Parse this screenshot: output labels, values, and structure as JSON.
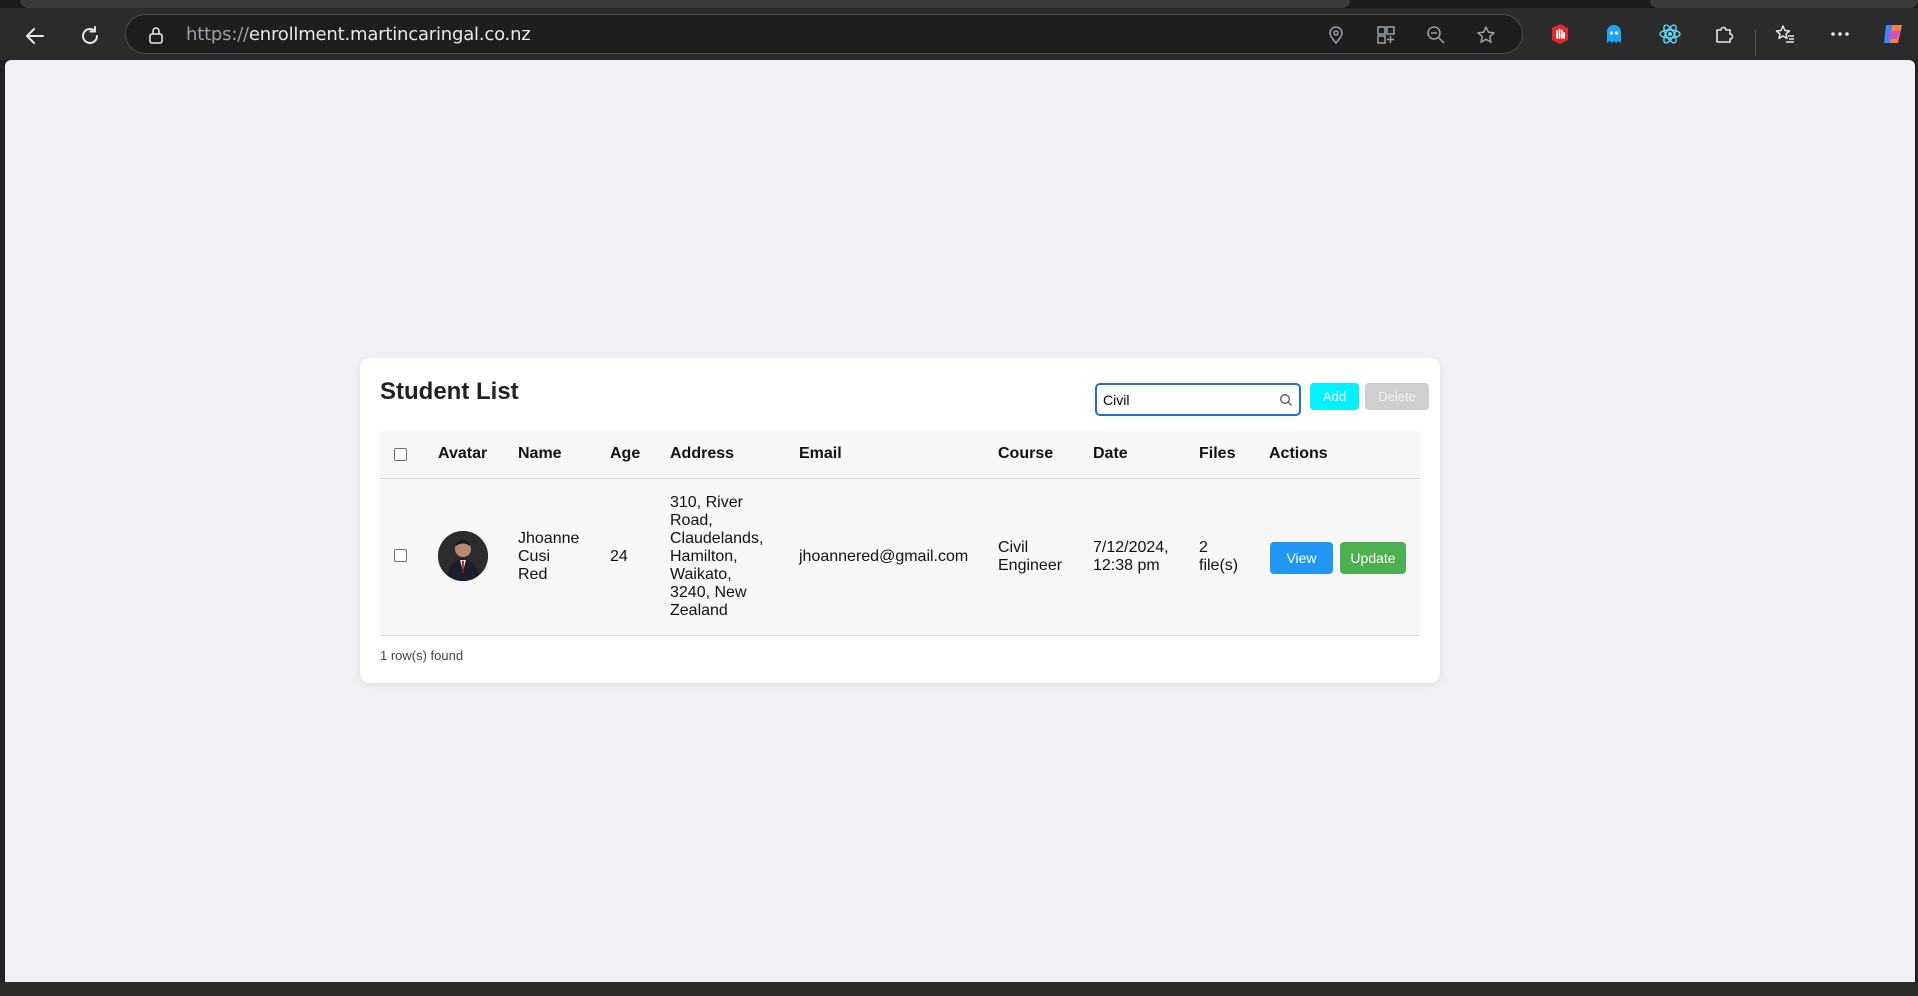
{
  "browser": {
    "url_scheme": "https://",
    "url_host": "enrollment.martincaringal.co.nz",
    "icons": [
      "back-icon",
      "refresh-icon",
      "lock-icon",
      "location-icon",
      "app-available-icon",
      "zoom-out-icon",
      "favorite-star-icon",
      "extension-hand-icon",
      "extension-ghost-icon",
      "extension-react-icon",
      "extensions-puzzle-icon",
      "favorites-icon",
      "more-icon",
      "copilot-icon"
    ]
  },
  "card": {
    "title": "Student List",
    "search": {
      "value": "Civil",
      "placeholder": ""
    },
    "add_label": "Add",
    "delete_label": "Delete",
    "footer_count": "1 row(s) found"
  },
  "table": {
    "headers": {
      "avatar": "Avatar",
      "name": "Name",
      "age": "Age",
      "address": "Address",
      "email": "Email",
      "course": "Course",
      "date": "Date",
      "files": "Files",
      "actions": "Actions"
    },
    "rows": [
      {
        "name_lines": [
          "Jhoanne",
          "Cusi",
          "Red"
        ],
        "age": "24",
        "address_lines": [
          "310, River",
          "Road,",
          "Claudelands,",
          "Hamilton,",
          "Waikato,",
          "3240, New",
          "Zealand"
        ],
        "email": "jhoannered@gmail.com",
        "course_lines": [
          "Civil",
          "Engineer"
        ],
        "date_lines": [
          "7/12/2024,",
          "12:38 pm"
        ],
        "files_lines": [
          "2",
          "file(s)"
        ],
        "view_label": "View",
        "update_label": "Update"
      }
    ]
  },
  "colors": {
    "add_button": "#00f2ff",
    "delete_button": "#cfcfcf",
    "view_button": "#2196f3",
    "update_button": "#4caf50",
    "search_border": "#1f6fd1",
    "page_background": "#f0f1f4"
  }
}
